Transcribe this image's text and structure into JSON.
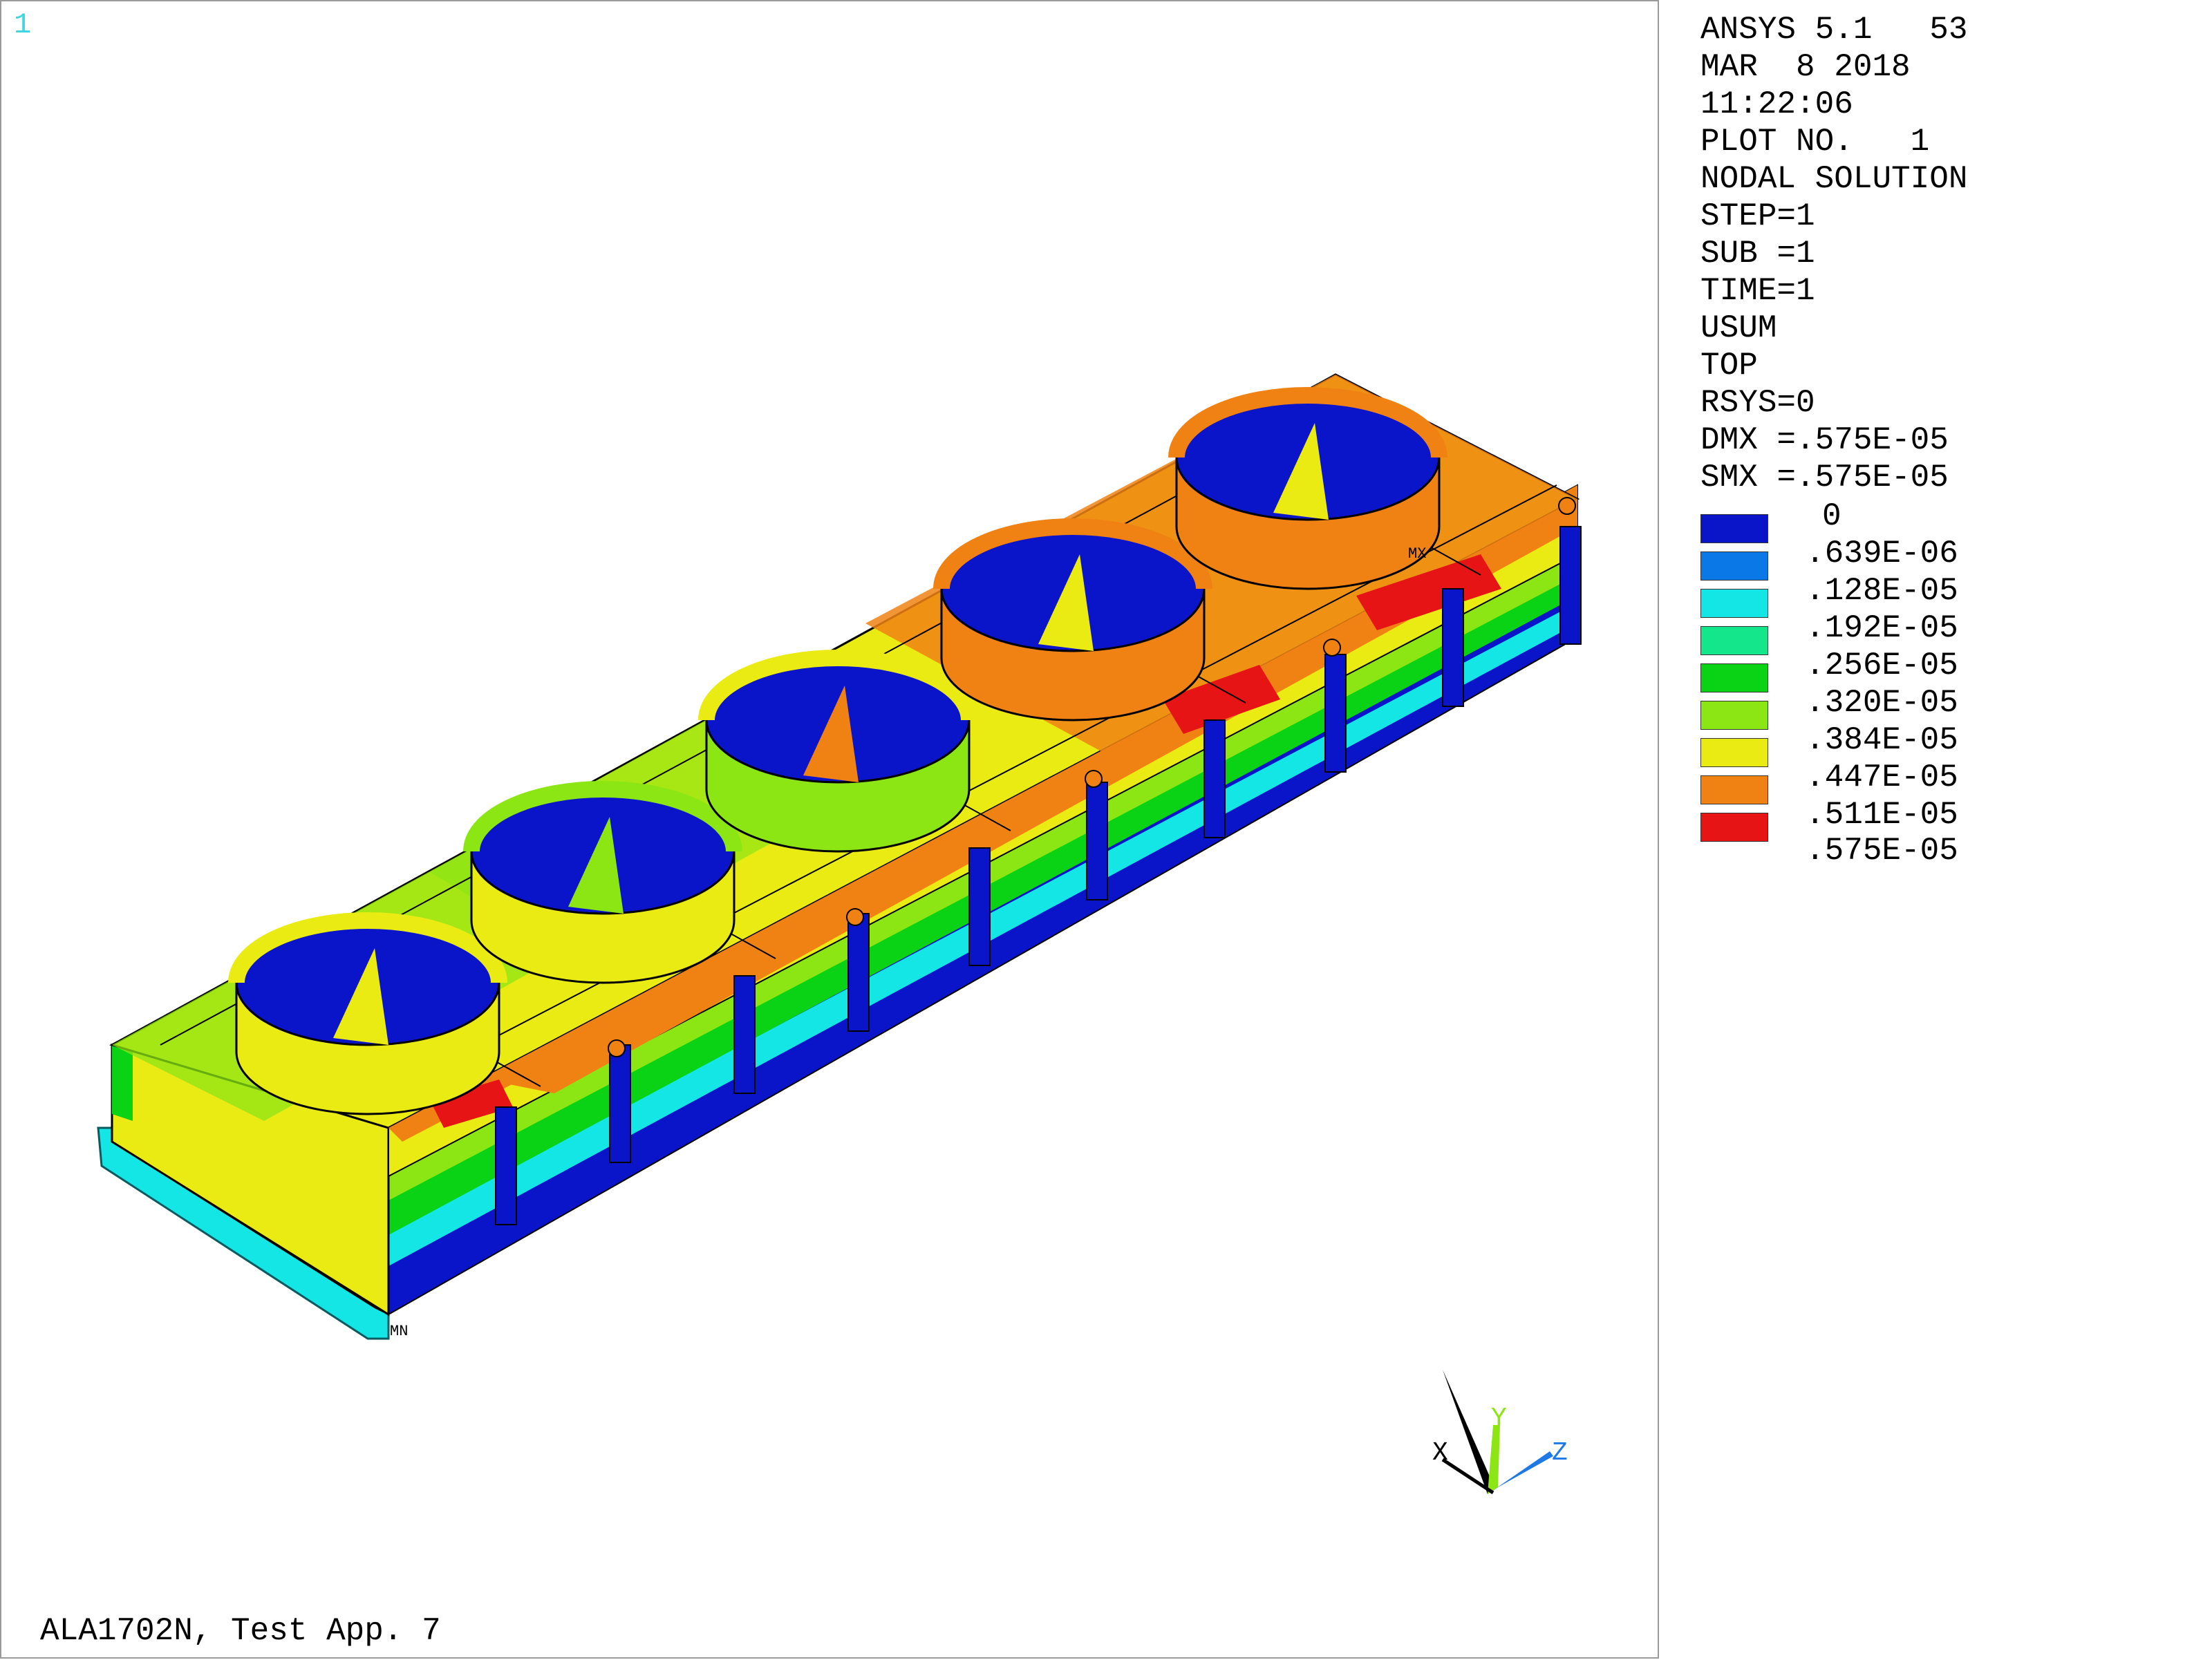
{
  "window_number": "1",
  "model_title": "ALA1702N, Test App. 7",
  "header_lines": [
    "ANSYS 5.1   53",
    "MAR  8 2018",
    "11:22:06",
    "PLOT NO.   1",
    "NODAL SOLUTION",
    "STEP=1",
    "SUB =1",
    "TIME=1",
    "USUM",
    "TOP",
    "RSYS=0",
    "DMX =.575E-05",
    "SMX =.575E-05"
  ],
  "legend": [
    {
      "value": "0",
      "color": "#0a14c8"
    },
    {
      "value": ".639E-06",
      "color": "#0a78e6"
    },
    {
      "value": ".128E-05",
      "color": "#14e6e6"
    },
    {
      "value": ".192E-05",
      "color": "#14e68c"
    },
    {
      "value": ".256E-05",
      "color": "#0ad214"
    },
    {
      "value": ".320E-05",
      "color": "#8ce614"
    },
    {
      "value": ".384E-05",
      "color": "#ebeb14"
    },
    {
      "value": ".447E-05",
      "color": "#f08214"
    },
    {
      "value": ".511E-05",
      "color": "#e61414"
    }
  ],
  "legend_max": ".575E-05",
  "markers": {
    "max": "MX",
    "min": "MN"
  },
  "axes": {
    "x": "X",
    "y": "Y",
    "z": "Z",
    "x_color": "#000000",
    "y_color": "#8ce614",
    "z_color": "#1e78e6"
  },
  "contour_colors": {
    "blue": "#0a14c8",
    "lightblue": "#0a78e6",
    "cyan": "#14e6e6",
    "teal": "#14e68c",
    "green": "#0ad214",
    "lime": "#8ce614",
    "yellow": "#ebeb14",
    "orange": "#f08214",
    "red": "#e61414"
  }
}
